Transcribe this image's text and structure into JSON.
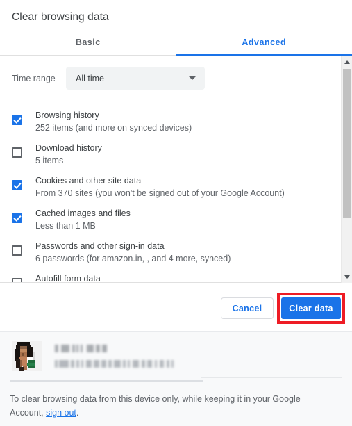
{
  "dialog": {
    "title": "Clear browsing data"
  },
  "tabs": [
    {
      "label": "Basic",
      "active": false
    },
    {
      "label": "Advanced",
      "active": true
    }
  ],
  "time_range": {
    "label": "Time range",
    "selected": "All time",
    "arrow_icon": "chevron-down-icon"
  },
  "items": [
    {
      "title": "Browsing history",
      "subtitle": "252 items (and more on synced devices)",
      "checked": true
    },
    {
      "title": "Download history",
      "subtitle": "5 items",
      "checked": false
    },
    {
      "title": "Cookies and other site data",
      "subtitle": "From 370 sites (you won't be signed out of your Google Account)",
      "checked": true
    },
    {
      "title": "Cached images and files",
      "subtitle": "Less than 1 MB",
      "checked": true
    },
    {
      "title": "Passwords and other sign-in data",
      "subtitle": "6 passwords (for amazon.in, , and 4 more, synced)",
      "checked": false
    },
    {
      "title": "Autofill form data",
      "subtitle": "",
      "checked": false
    }
  ],
  "scrollbar": {
    "up_icon": "scroll-up-arrow-icon",
    "down_icon": "scroll-down-arrow-icon"
  },
  "buttons": {
    "cancel": "Cancel",
    "clear": "Clear data"
  },
  "highlight": {
    "color": "#ee1c25",
    "target": "clear-data-button"
  },
  "footer": {
    "account_name_redacted": "",
    "account_email_redacted": "",
    "note_prefix": "To clear browsing data from this device only, while keeping it in your Google Account, ",
    "note_link": "sign out",
    "note_suffix": "."
  },
  "colors": {
    "accent": "#1a73e8",
    "text_primary": "#3c4043",
    "text_secondary": "#5f6368",
    "footer_bg": "#f8f9fa",
    "highlight": "#ee1c25"
  }
}
